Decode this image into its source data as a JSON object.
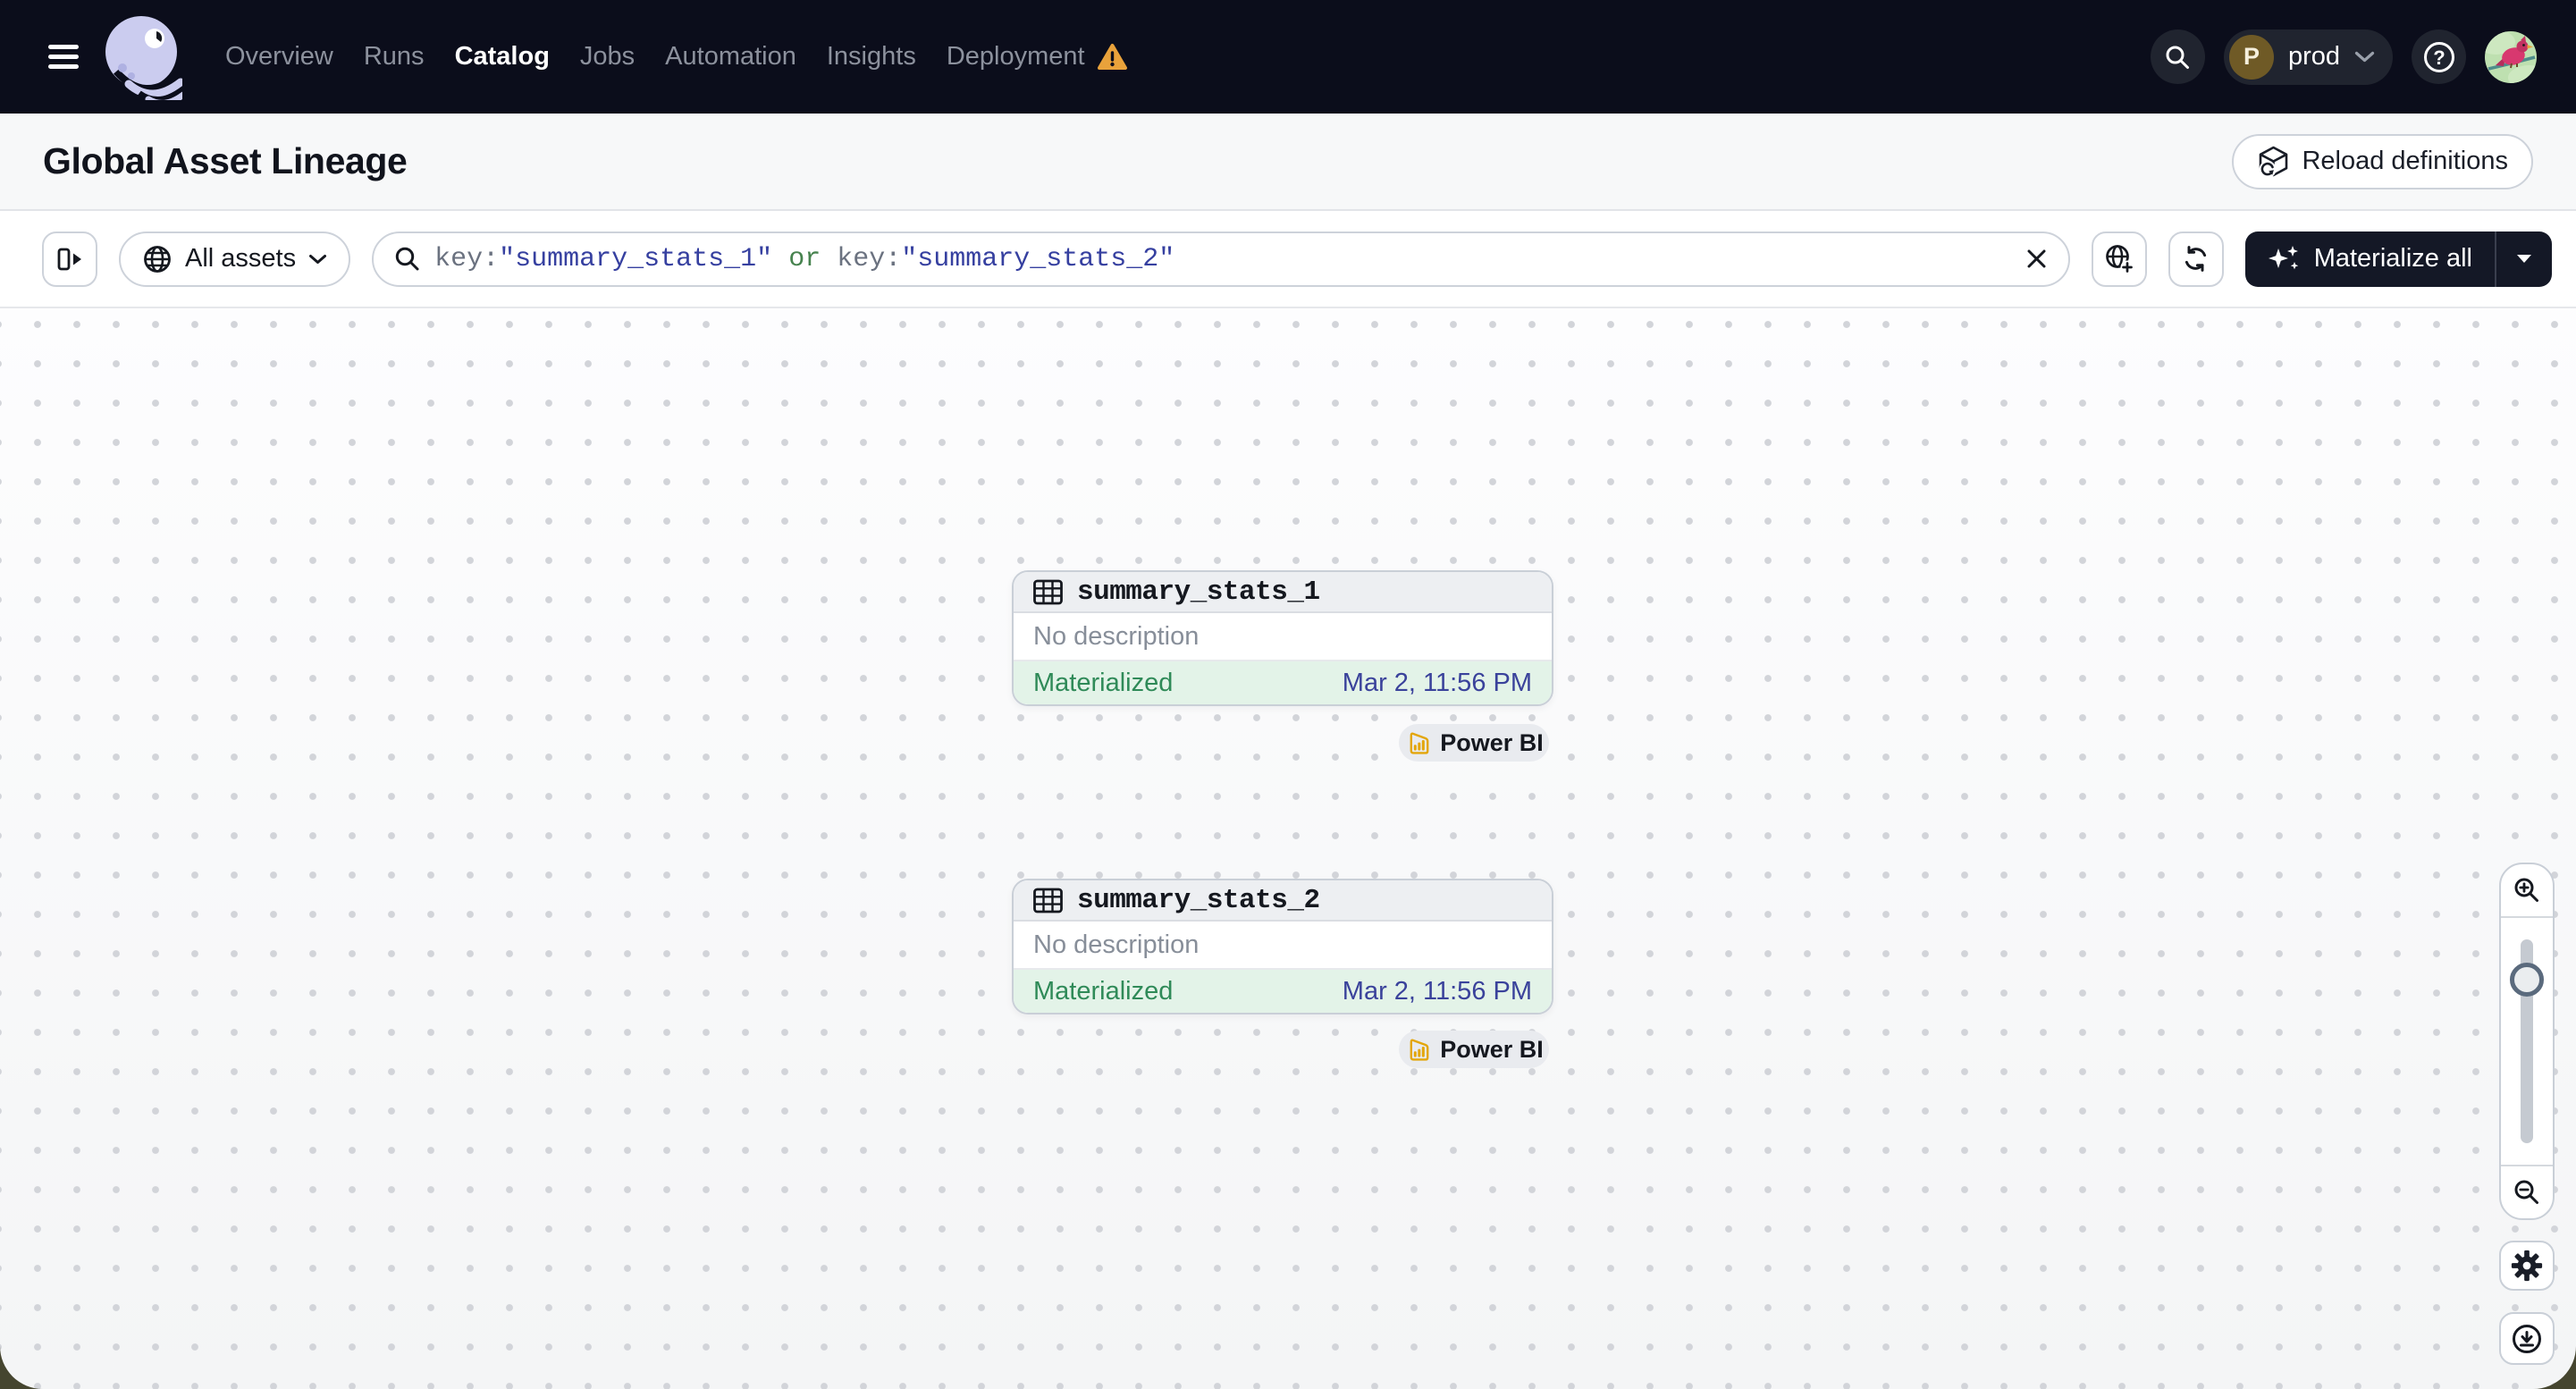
{
  "navbar": {
    "items": [
      {
        "label": "Overview"
      },
      {
        "label": "Runs"
      },
      {
        "label": "Catalog"
      },
      {
        "label": "Jobs"
      },
      {
        "label": "Automation"
      },
      {
        "label": "Insights"
      },
      {
        "label": "Deployment"
      }
    ],
    "active_item": "Catalog",
    "deployment_has_warning": true,
    "environment": {
      "initial": "P",
      "name": "prod"
    }
  },
  "header": {
    "title": "Global Asset Lineage",
    "reload_button": "Reload definitions"
  },
  "toolbar": {
    "asset_filter": "All assets",
    "search": {
      "parts": [
        {
          "text": "key:",
          "type": "key"
        },
        {
          "text": "\"summary_stats_1\"",
          "type": "value"
        },
        {
          "text": " or ",
          "type": "operator"
        },
        {
          "text": "key:",
          "type": "key"
        },
        {
          "text": "\"summary_stats_2\"",
          "type": "value"
        }
      ]
    },
    "materialize_button": "Materialize all"
  },
  "graph": {
    "nodes": [
      {
        "name": "summary_stats_1",
        "description": "No description",
        "status": "Materialized",
        "materialized_at": "Mar 2, 11:56 PM",
        "tag": "Power BI"
      },
      {
        "name": "summary_stats_2",
        "description": "No description",
        "status": "Materialized",
        "materialized_at": "Mar 2, 11:56 PM",
        "tag": "Power BI"
      }
    ]
  },
  "colors": {
    "navbar_bg": "#0B0D1B",
    "warning": "#E9A23B",
    "status_green_text": "#2F8A58",
    "status_green_bg": "#E3F3E8",
    "timestamp_blue": "#3A429B",
    "query_key": "#6B7280",
    "query_value": "#3640A0",
    "query_operator": "#47834F",
    "powerbi_gold": "#E3A60B"
  }
}
